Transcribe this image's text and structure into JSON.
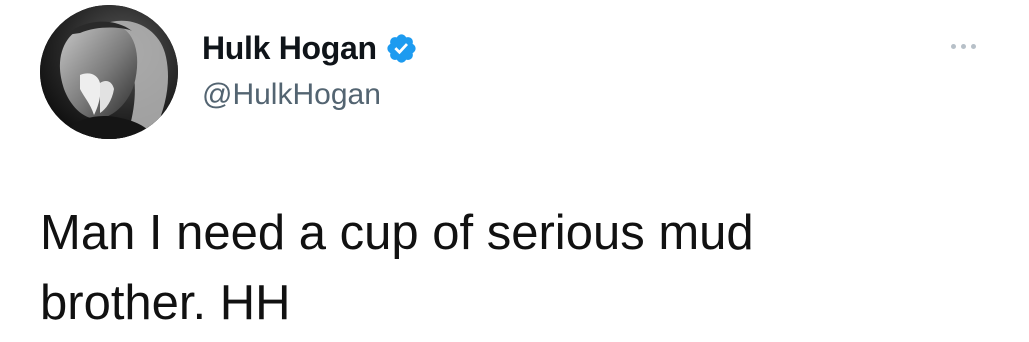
{
  "tweet": {
    "author": {
      "display_name": "Hulk Hogan",
      "handle": "@HulkHogan",
      "verified": true,
      "verified_icon": "verified-badge-icon",
      "avatar": "profile-photo"
    },
    "more_icon": "more-options-icon",
    "text": "Man I need a cup of serious mud\nbrother. HH"
  },
  "colors": {
    "verified_badge": "#1d9bf0",
    "handle_text": "#536471",
    "primary_text": "#0f1419",
    "more_dots": "#b7c0c8",
    "background": "#ffffff"
  }
}
